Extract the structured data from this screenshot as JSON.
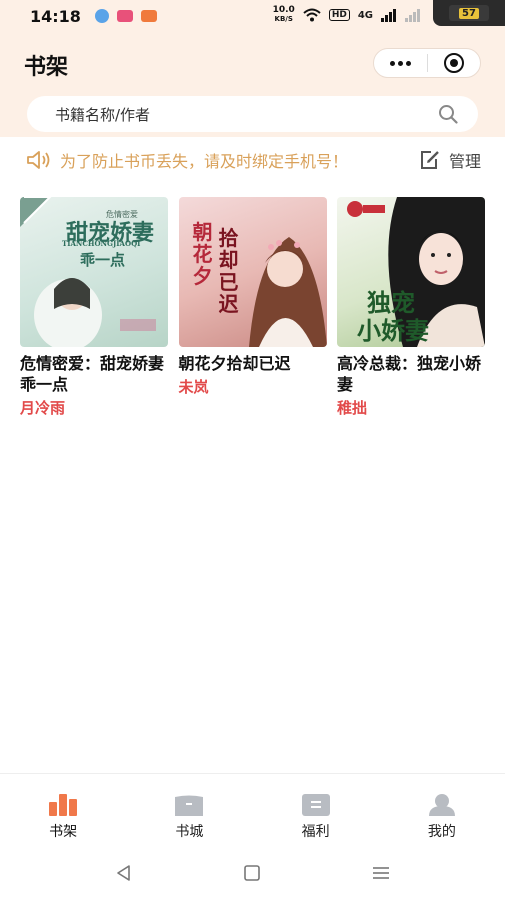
{
  "status": {
    "time": "14:18",
    "net_speed_value": "10.0",
    "net_speed_unit": "KB/S",
    "hd": "HD",
    "network": "4G",
    "battery": "57"
  },
  "header": {
    "title": "书架"
  },
  "search": {
    "placeholder": "书籍名称/作者"
  },
  "notice": {
    "text": "为了防止书币丢失，请及时绑定手机号！",
    "manage_label": "管理"
  },
  "books": [
    {
      "title": "危情密爱：甜宠娇妻乖一点",
      "author": "月冷雨",
      "cover_text": "甜宠娇妻",
      "cover_sub": "乖一点",
      "cover_small": "危情密爱",
      "cover_pinyin": "TIANCHONGJIAOQI"
    },
    {
      "title": "朝花夕拾却已迟",
      "author": "未岚",
      "cover_text": "朝花夕",
      "cover_sub": "拾却已迟"
    },
    {
      "title": "高冷总裁：独宠小娇妻",
      "author": "稚拙",
      "cover_text": "独宠",
      "cover_sub": "小娇妻"
    }
  ],
  "tabs": [
    {
      "label": "书架",
      "active": true
    },
    {
      "label": "书城",
      "active": false
    },
    {
      "label": "福利",
      "active": false
    },
    {
      "label": "我的",
      "active": false
    }
  ],
  "colors": {
    "accent": "#f0784a",
    "notice": "#d9a15a",
    "author": "#e24a4a",
    "header_bg": "#fdf0e6"
  }
}
